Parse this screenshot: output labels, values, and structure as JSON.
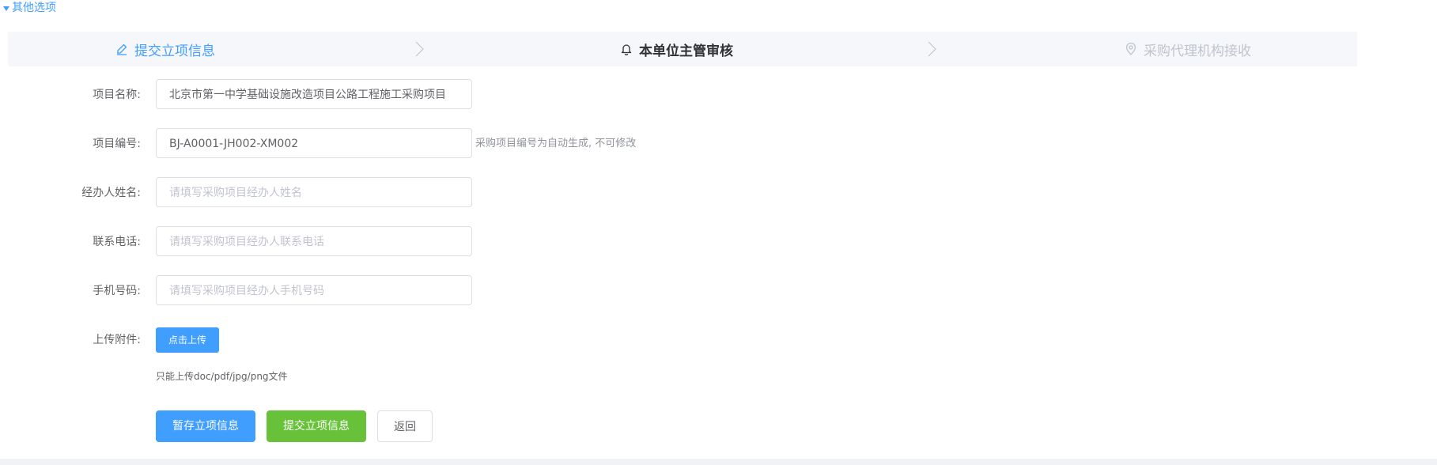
{
  "toggle": {
    "label": "其他选项"
  },
  "steps": [
    {
      "label": "提交立项信息",
      "status": "done",
      "icon": "edit-icon"
    },
    {
      "label": "本单位主管审核",
      "status": "active",
      "icon": "bell-icon"
    },
    {
      "label": "采购代理机构接收",
      "status": "wait",
      "icon": "location-icon"
    }
  ],
  "form": {
    "project_name": {
      "label": "项目名称:",
      "value": "北京市第一中学基础设施改造项目公路工程施工采购项目"
    },
    "project_code": {
      "label": "项目编号:",
      "value": "BJ-A0001-JH002-XM002",
      "hint": "采购项目编号为自动生成, 不可修改"
    },
    "handler_name": {
      "label": "经办人姓名:",
      "placeholder": "请填写采购项目经办人姓名"
    },
    "contact_phone": {
      "label": "联系电话:",
      "placeholder": "请填写采购项目经办人联系电话"
    },
    "mobile": {
      "label": "手机号码:",
      "placeholder": "请填写采购项目经办人手机号码"
    },
    "attachment": {
      "label": "上传附件:",
      "button": "点击上传",
      "tip": "只能上传doc/pdf/jpg/png文件"
    }
  },
  "actions": {
    "save": "暂存立项信息",
    "submit": "提交立项信息",
    "back": "返回"
  },
  "colors": {
    "primary": "#409eff",
    "success": "#67c23a",
    "step_bg": "#f5f7fa"
  }
}
